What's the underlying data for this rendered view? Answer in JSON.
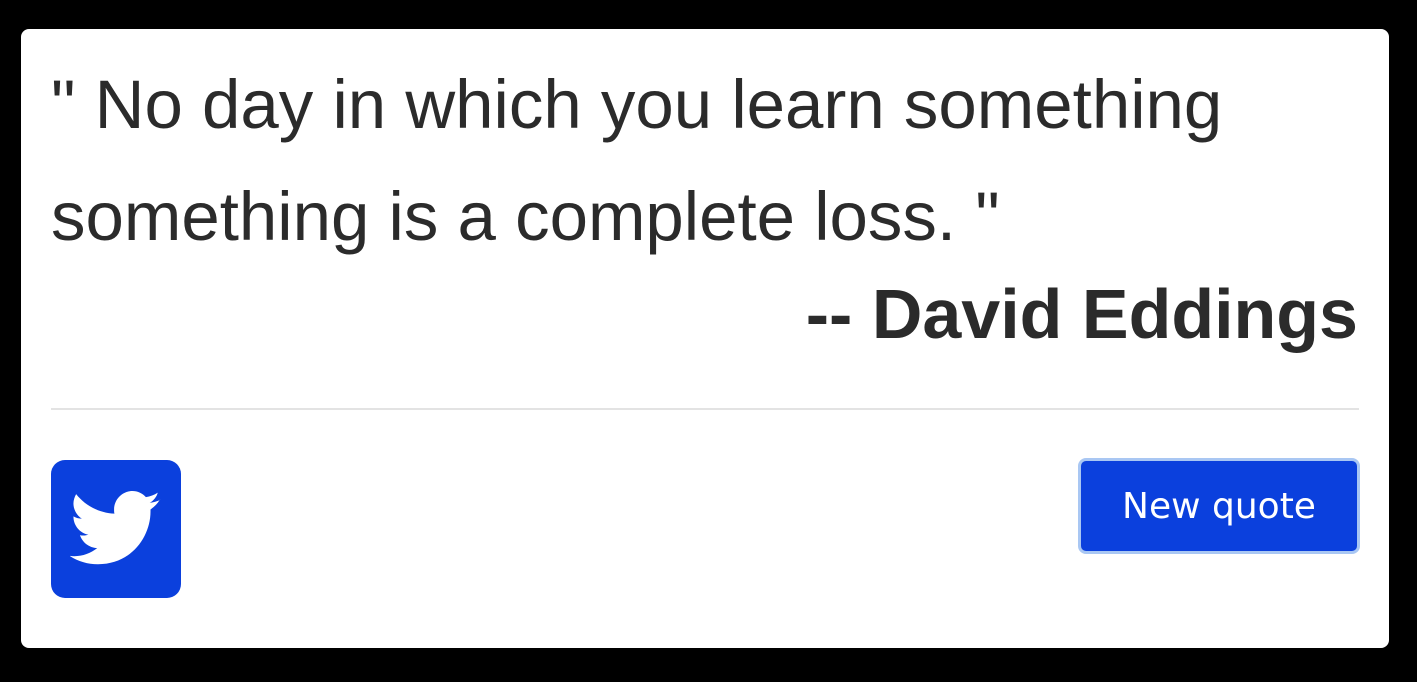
{
  "quote": {
    "text": "\" No day in which you learn something something is a complete loss. \"",
    "author": "-- David Eddings"
  },
  "actions": {
    "tweet_icon": "twitter-icon",
    "new_quote_label": "New quote"
  },
  "colors": {
    "background": "#000000",
    "card": "#ffffff",
    "accent": "#0b40dd",
    "focus_ring": "#a9c7f3",
    "text": "#2b2b2b"
  }
}
